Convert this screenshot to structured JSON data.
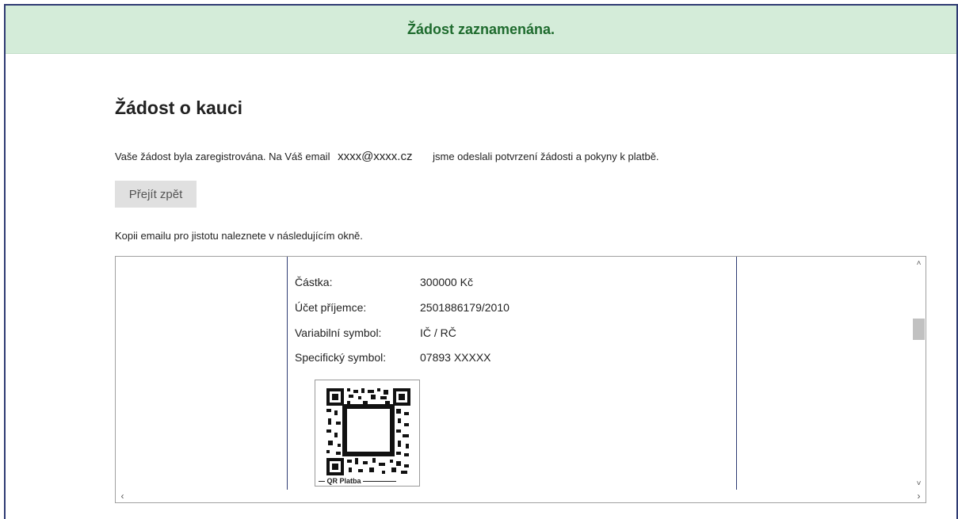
{
  "banner": {
    "text": "Žádost zaznamenána."
  },
  "page": {
    "heading": "Žádost o kauci",
    "info_prefix": "Vaše žádost byla zaregistrována. Na Váš email",
    "email": "xxxx@xxxx.cz",
    "info_suffix": "jsme odeslali potvrzení žádosti a pokyny k platbě.",
    "back_button": "Přejít zpět",
    "copy_note": "Kopii emailu pro jistotu naleznete v následujícím okně."
  },
  "email_preview": {
    "rows": [
      {
        "label": "Částka:",
        "value": "300000 Kč"
      },
      {
        "label": "Účet příjemce:",
        "value": "2501886179/2010"
      },
      {
        "label": "Variabilní symbol:",
        "value": "IČ / RČ"
      },
      {
        "label": "Specifický symbol:",
        "value": "07893 XXXXX"
      }
    ],
    "qr_label": "QR Platba"
  },
  "colors": {
    "banner_bg": "#d4ecd9",
    "banner_text": "#1e6b2e",
    "frame_border": "#2f3b73"
  },
  "icons": {
    "scroll_up": "chevron-up-icon",
    "scroll_down": "chevron-down-icon",
    "scroll_left": "chevron-left-icon",
    "scroll_right": "chevron-right-icon"
  }
}
